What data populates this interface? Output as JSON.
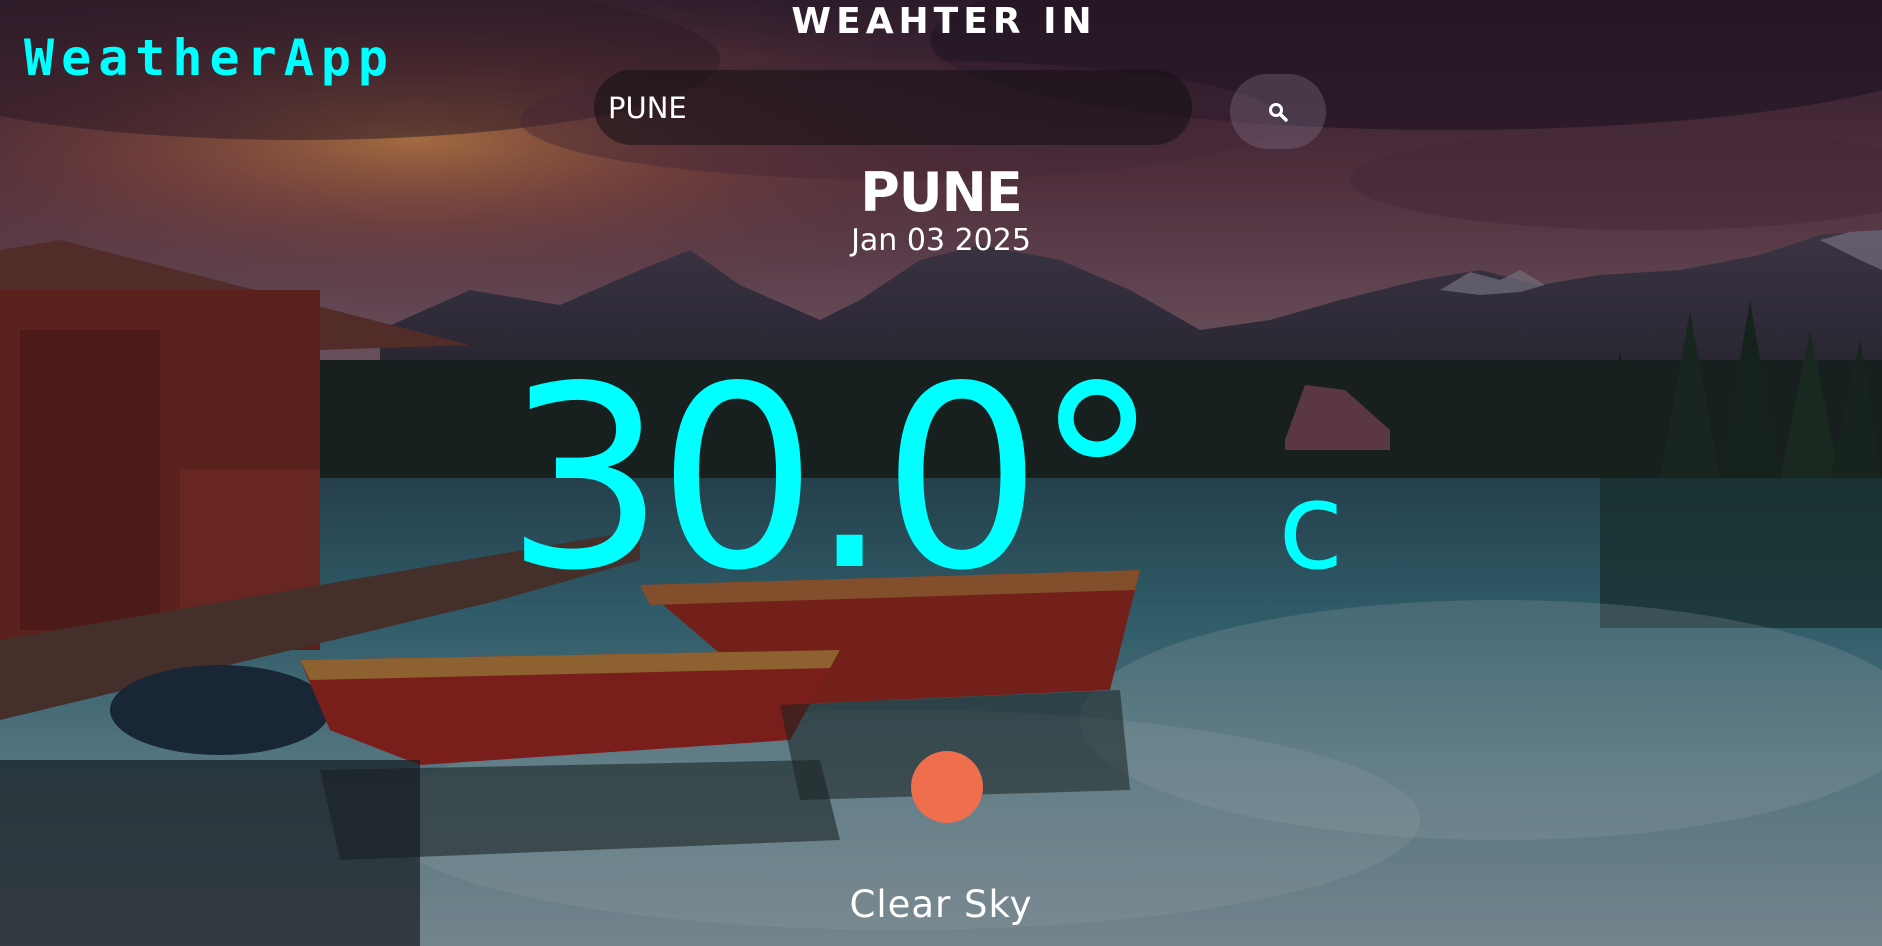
{
  "brand": {
    "name": "WeatherApp",
    "color": "#00ffff"
  },
  "header": {
    "title": "WEAHTER IN"
  },
  "search": {
    "value": "PUNE",
    "button_icon": "search-icon"
  },
  "weather": {
    "city": "PUNE",
    "date": "Jan 03 2025",
    "temperature": "30.0°",
    "unit": "c",
    "temperature_color": "#00ffff",
    "condition": "Clear Sky",
    "condition_icon": "sun-icon",
    "condition_icon_color": "#ee6e4e"
  },
  "background": {
    "scene": "lake-mountains-boats-photo"
  }
}
